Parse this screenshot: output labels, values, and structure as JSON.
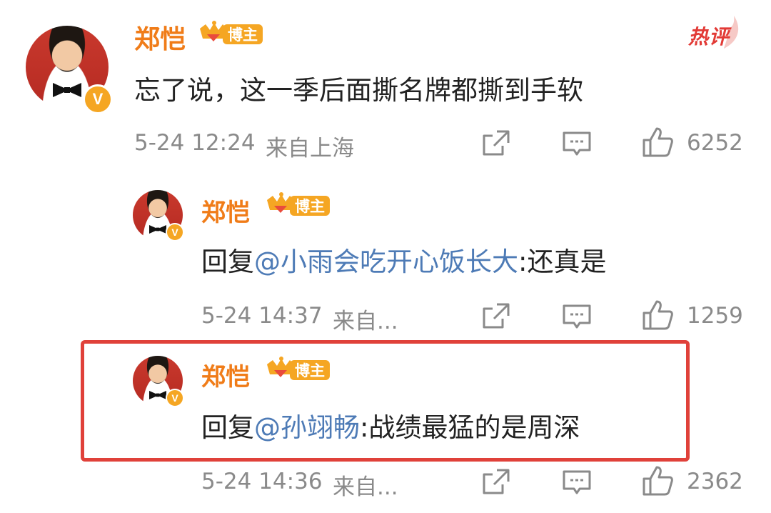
{
  "hot_tag": "热评",
  "colors": {
    "username": "#f07c18",
    "mention": "#4e7bb6",
    "meta": "#8a8a8a",
    "highlight": "#e0413a",
    "hot_tag": "#e23a36"
  },
  "comment": {
    "username": "郑恺",
    "badge": "博主",
    "text": "忘了说，这一季后面撕名牌都撕到手软",
    "time": "5-24 12:24",
    "location": "来自上海",
    "likes": "6252"
  },
  "replies": [
    {
      "username": "郑恺",
      "badge": "博主",
      "prefix": "回复",
      "mention": "@小雨会吃开心饭长大",
      "text": ":还真是",
      "time": "5-24 14:37",
      "location": "来自...",
      "likes": "1259"
    },
    {
      "username": "郑恺",
      "badge": "博主",
      "prefix": "回复",
      "mention": "@孙翊畅",
      "text": ":战绩最猛的是周深",
      "time": "5-24 14:36",
      "location": "来自...",
      "likes": "2362"
    }
  ]
}
